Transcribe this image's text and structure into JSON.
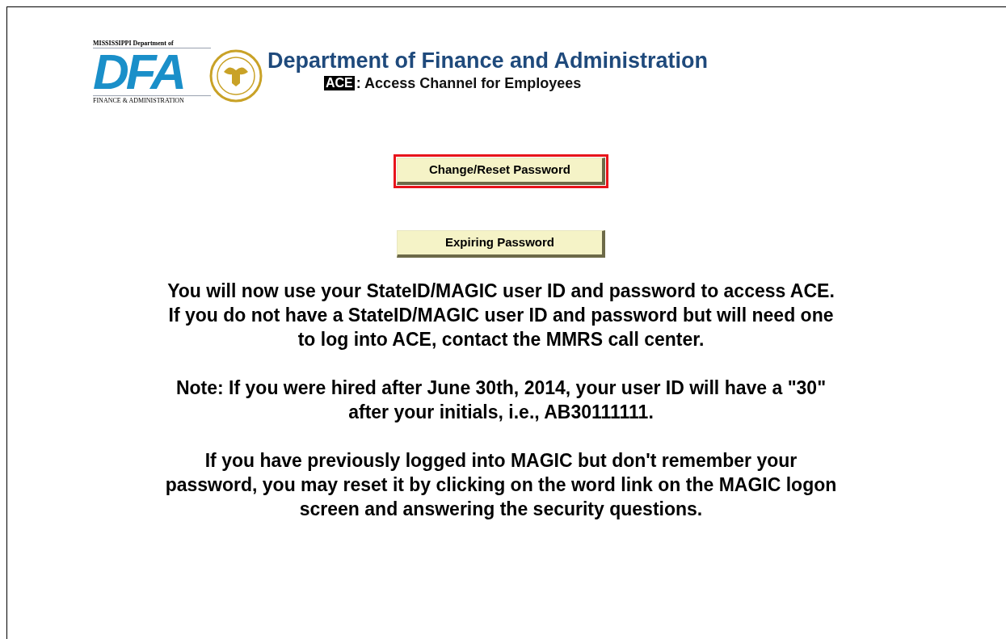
{
  "logo": {
    "top_text": "MISSISSIPPI Department of",
    "letters": "DFA",
    "bottom_text": "FINANCE & ADMINISTRATION"
  },
  "header": {
    "title": "Department of Finance and Administration",
    "badge": "ACE",
    "subtitle": ": Access Channel for Employees"
  },
  "buttons": [
    {
      "label": "Change/Reset Password",
      "highlighted": true
    },
    {
      "label": "Expiring Password",
      "highlighted": false
    }
  ],
  "paragraphs": [
    {
      "lines": [
        "You will now use your StateID/MAGIC user ID and password to access ACE.",
        "If you do not have a StateID/MAGIC user ID and password but will need one",
        "to log into ACE, contact the MMRS call center."
      ]
    },
    {
      "lines": [
        "Note: If you were hired after June 30th, 2014, your user ID will have a \"30\"",
        "after your initials, i.e., AB30111111."
      ]
    },
    {
      "lines": [
        "If you have previously logged into MAGIC but don't remember your",
        "password, you may reset it by clicking on the word link on the MAGIC logon",
        "screen and answering the security questions."
      ]
    }
  ]
}
